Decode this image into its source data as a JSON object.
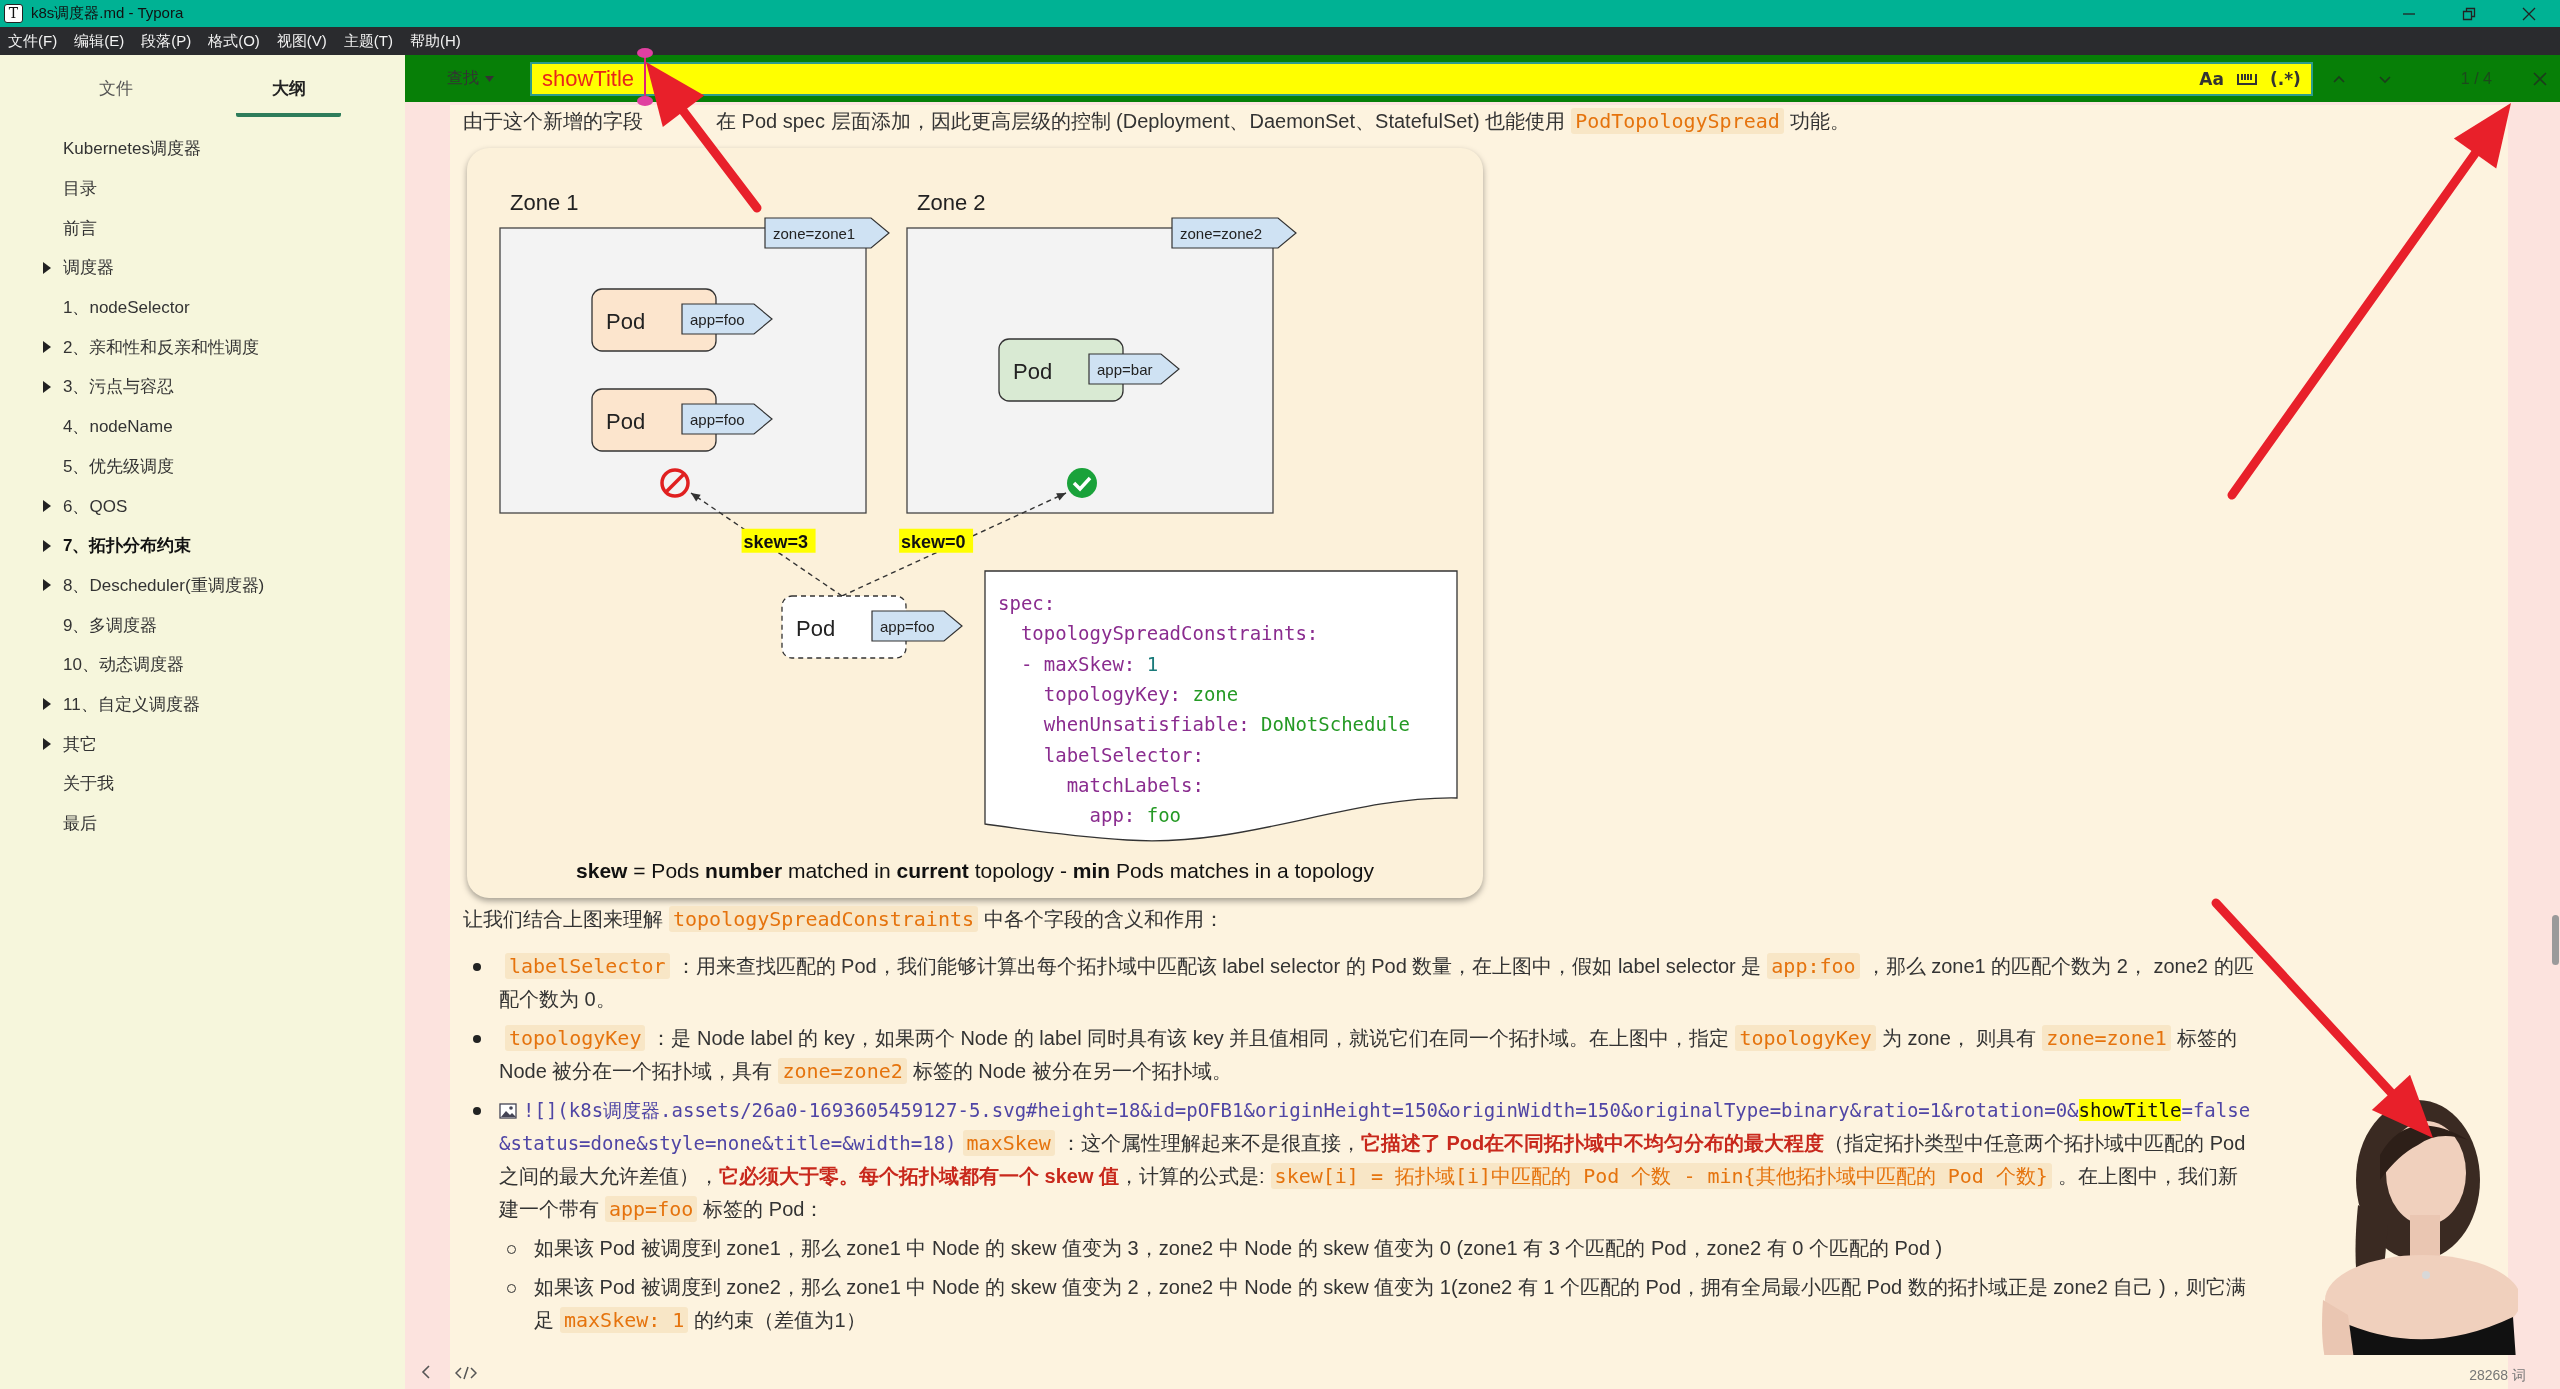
{
  "window": {
    "app_icon": "T",
    "title": "k8s调度器.md - Typora"
  },
  "menu": [
    "文件(F)",
    "编辑(E)",
    "段落(P)",
    "格式(O)",
    "视图(V)",
    "主题(T)",
    "帮助(H)"
  ],
  "sidebar": {
    "tabs": [
      {
        "label": "文件",
        "selected": false
      },
      {
        "label": "大纲",
        "selected": true
      }
    ],
    "items": [
      {
        "label": "Kubernetes调度器",
        "collapsed": false,
        "current": false
      },
      {
        "label": "目录",
        "collapsed": false,
        "current": false
      },
      {
        "label": "前言",
        "collapsed": false,
        "current": false
      },
      {
        "label": "调度器",
        "collapsed": true,
        "current": false
      },
      {
        "label": "1、nodeSelector",
        "collapsed": false,
        "current": false
      },
      {
        "label": "2、亲和性和反亲和性调度",
        "collapsed": true,
        "current": false
      },
      {
        "label": "3、污点与容忍",
        "collapsed": true,
        "current": false
      },
      {
        "label": "4、nodeName",
        "collapsed": false,
        "current": false
      },
      {
        "label": "5、优先级调度",
        "collapsed": false,
        "current": false
      },
      {
        "label": "6、QOS",
        "collapsed": true,
        "current": false
      },
      {
        "label": "7、拓扑分布约束",
        "collapsed": true,
        "current": true
      },
      {
        "label": "8、Descheduler(重调度器)",
        "collapsed": true,
        "current": false
      },
      {
        "label": "9、多调度器",
        "collapsed": false,
        "current": false
      },
      {
        "label": "10、动态调度器",
        "collapsed": false,
        "current": false
      },
      {
        "label": "11、自定义调度器",
        "collapsed": true,
        "current": false
      },
      {
        "label": "其它",
        "collapsed": true,
        "current": false
      },
      {
        "label": "关于我",
        "collapsed": false,
        "current": false
      },
      {
        "label": "最后",
        "collapsed": false,
        "current": false
      }
    ]
  },
  "find_bar": {
    "mode": "查找",
    "value": "showTitle",
    "options": [
      {
        "kind": "text",
        "label": "Aa"
      },
      {
        "kind": "whole-word"
      },
      {
        "kind": "text",
        "label": "(.*)"
      }
    ],
    "count": "1 / 4"
  },
  "document": {
    "intro": [
      {
        "kind": "text",
        "text": "由于这个新增的字段"
      },
      {
        "kind": "covered"
      },
      {
        "kind": "text",
        "text": "在 Pod spec 层面添加，因此更高层级的控制 (Deployment、DaemonSet、StatefulSet) 也能使用"
      },
      {
        "kind": "code",
        "text": "PodTopologySpread"
      },
      {
        "kind": "text",
        "text": "功能。"
      }
    ],
    "figure": {
      "zones": [
        {
          "label": "Zone 1",
          "tag": "zone=zone1",
          "kind": "blocked",
          "skew": "skew=3",
          "pods": [
            {
              "label": "Pod",
              "tag": "app=foo",
              "kind": "matched"
            },
            {
              "label": "Pod",
              "tag": "app=foo",
              "kind": "matched"
            }
          ]
        },
        {
          "label": "Zone 2",
          "tag": "zone=zone2",
          "kind": "allowed",
          "skew": "skew=0",
          "pods": [
            {
              "label": "Pod",
              "tag": "app=bar",
              "kind": "other"
            }
          ]
        }
      ],
      "new_pod": {
        "label": "Pod",
        "tag": "app=foo"
      },
      "spec": [
        [
          {
            "kind": "key",
            "text": "spec:"
          }
        ],
        [
          {
            "kind": "key",
            "text": "  topologySpreadConstraints:"
          }
        ],
        [
          {
            "kind": "key",
            "text": "  - maxSkew: "
          },
          {
            "kind": "number",
            "text": "1"
          }
        ],
        [
          {
            "kind": "key",
            "text": "    topologyKey: "
          },
          {
            "kind": "value",
            "text": "zone"
          }
        ],
        [
          {
            "kind": "key",
            "text": "    whenUnsatisfiable: "
          },
          {
            "kind": "value",
            "text": "DoNotSchedule"
          }
        ],
        [
          {
            "kind": "key",
            "text": "    labelSelector:"
          }
        ],
        [
          {
            "kind": "key",
            "text": "      matchLabels:"
          }
        ],
        [
          {
            "kind": "key",
            "text": "        app: "
          },
          {
            "kind": "value",
            "text": "foo"
          }
        ]
      ],
      "caption": "**skew** = Pods **number** matched in **current** topology - **min** Pods matches in a topology"
    },
    "lead": [
      {
        "kind": "text",
        "text": "让我们结合上图来理解"
      },
      {
        "kind": "code",
        "text": "topologySpreadConstraints"
      },
      {
        "kind": "text",
        "text": "中各个字段的含义和作用："
      }
    ],
    "bullets": [
      {
        "image_icon": false,
        "segments": [
          {
            "kind": "code",
            "text": "labelSelector"
          },
          {
            "kind": "text",
            "text": "：用来查找匹配的 Pod，我们能够计算出每个拓扑域中匹配该 label selector 的 Pod 数量，在上图中，假如 label selector 是"
          },
          {
            "kind": "code",
            "text": "app:foo"
          },
          {
            "kind": "text",
            "text": "，那么 zone1 的匹配个数为 2， zone2 的匹配个数为 0。"
          }
        ]
      },
      {
        "image_icon": false,
        "segments": [
          {
            "kind": "code",
            "text": "topologyKey"
          },
          {
            "kind": "text",
            "text": "：是 Node label 的 key，如果两个 Node 的 label 同时具有该 key 并且值相同，就说它们在同一个拓扑域。在上图中，指定"
          },
          {
            "kind": "code",
            "text": "topologyKey"
          },
          {
            "kind": "text",
            "text": "为 zone， 则具有"
          },
          {
            "kind": "code",
            "text": "zone=zone1"
          },
          {
            "kind": "text",
            "text": "标签的 Node 被分在一个拓扑域，具有"
          },
          {
            "kind": "code",
            "text": "zone=zone2"
          },
          {
            "kind": "text",
            "text": "标签的 Node 被分在另一个拓扑域。"
          }
        ]
      },
      {
        "image_icon": true,
        "segments": [
          {
            "kind": "source",
            "text": "![](k8s调度器.assets/26a0-1693605459127-5.svg#height=18&id=pOFB1&originHeight=150&originWidth=150&originalType=binary&ratio=1&rotation=0&"
          },
          {
            "kind": "match",
            "text": "showTitle"
          },
          {
            "kind": "source",
            "text": "=false&status=done&style=none&title=&width=18)"
          },
          {
            "kind": "code",
            "text": "maxSkew"
          },
          {
            "kind": "text",
            "text": "：这个属性理解起来不是很直接，"
          },
          {
            "kind": "strong",
            "text": "它描述了 Pod在不同拓扑域中不均匀分布的最大程度"
          },
          {
            "kind": "text",
            "text": "（指定拓扑类型中任意两个拓扑域中匹配的 Pod 之间的最大允许差值），"
          },
          {
            "kind": "strong",
            "text": "它必须大于零。每个拓扑域都有一个 skew 值"
          },
          {
            "kind": "text",
            "text": "，计算的公式是:"
          },
          {
            "kind": "code",
            "text": "skew[i] = 拓扑域[i]中匹配的 Pod 个数 - min{其他拓扑域中匹配的 Pod 个数}"
          },
          {
            "kind": "text",
            "text": "。在上图中，我们新建一个带有"
          },
          {
            "kind": "code",
            "text": "app=foo"
          },
          {
            "kind": "text",
            "text": "标签的 Pod："
          }
        ],
        "children": [
          {
            "segments": [
              {
                "kind": "text",
                "text": "如果该 Pod 被调度到 zone1，那么 zone1 中 Node 的 skew 值变为 3，zone2 中 Node 的 skew 值变为 0 (zone1 有 3 个匹配的 Pod，zone2 有 0 个匹配的 Pod )"
              }
            ]
          },
          {
            "segments": [
              {
                "kind": "text",
                "text": "如果该 Pod 被调度到 zone2，那么 zone1 中 Node 的 skew 值变为 2，zone2 中 Node 的 skew 值变为 1(zone2 有 1 个匹配的 Pod，拥有全局最小匹配 Pod 数的拓扑域正是 zone2 自己 )，则它满足"
              },
              {
                "kind": "code",
                "text": "maxSkew: 1"
              },
              {
                "kind": "text",
                "text": "的约束（差值为1）"
              }
            ]
          }
        ]
      }
    ]
  },
  "word_count": "28268 词"
}
